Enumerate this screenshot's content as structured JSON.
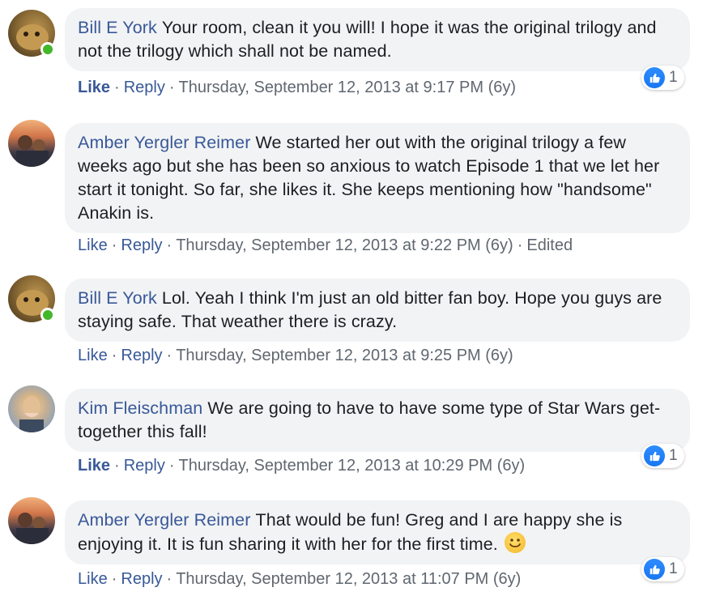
{
  "colors": {
    "link": "#385898",
    "bubble": "#f2f3f5",
    "meta": "#606770",
    "online": "#42b72a",
    "like_blue": "#1877f2"
  },
  "comments": [
    {
      "author": "Bill E York",
      "text": "Your room, clean it you will! I hope it was the original trilogy and not the trilogy which shall not be named.",
      "like": "Like",
      "reply": "Reply",
      "timestamp": "Thursday, September 12, 2013 at 9:17 PM (6y)",
      "reaction_count": "1",
      "liked": true
    },
    {
      "author": "Amber Yergler Reimer",
      "text": "We started her out with the original trilogy a few weeks ago but she has been so anxious to watch Episode 1 that we let her start it tonight. So far, she likes it. She keeps mentioning how \"handsome\" Anakin is.",
      "like": "Like",
      "reply": "Reply",
      "timestamp": "Thursday, September 12, 2013 at 9:22 PM (6y)",
      "edited": "Edited"
    },
    {
      "author": "Bill E York",
      "text": "Lol. Yeah I think I'm just an old bitter fan boy. Hope you guys are staying safe. That weather there is crazy.",
      "like": "Like",
      "reply": "Reply",
      "timestamp": "Thursday, September 12, 2013 at 9:25 PM (6y)"
    },
    {
      "author": "Kim Fleischman",
      "text": "We are going to have to have some type of Star Wars get-together this fall!",
      "like": "Like",
      "reply": "Reply",
      "timestamp": "Thursday, September 12, 2013 at 10:29 PM (6y)",
      "reaction_count": "1",
      "liked": true
    },
    {
      "author": "Amber Yergler Reimer",
      "text": "That would be fun! Greg and I are happy she is enjoying it. It is fun sharing it with her for the first time.",
      "like": "Like",
      "reply": "Reply",
      "timestamp": "Thursday, September 12, 2013 at 11:07 PM (6y)",
      "reaction_count": "1",
      "emoji": "smiley-emoji"
    }
  ]
}
